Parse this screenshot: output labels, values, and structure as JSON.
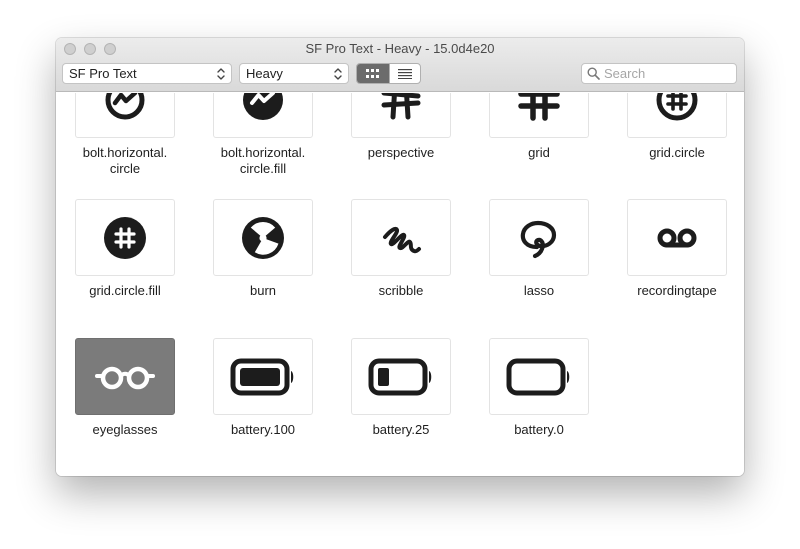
{
  "window": {
    "title": "SF Pro Text - Heavy - 15.0d4e20"
  },
  "toolbar": {
    "font_family": "SF Pro Text",
    "font_weight": "Heavy",
    "view_modes": [
      "grid-view",
      "list-view"
    ],
    "active_view": "grid-view",
    "search_placeholder": "Search"
  },
  "symbols": [
    {
      "name": "bolt.horizontal.circle",
      "label": "bolt.horizontal.\ncircle",
      "icon": "bolt-horizontal-circle-icon"
    },
    {
      "name": "bolt.horizontal.circle.fill",
      "label": "bolt.horizontal.\ncircle.fill",
      "icon": "bolt-horizontal-circle-fill-icon"
    },
    {
      "name": "perspective",
      "label": "perspective",
      "icon": "perspective-icon"
    },
    {
      "name": "grid",
      "label": "grid",
      "icon": "grid-icon"
    },
    {
      "name": "grid.circle",
      "label": "grid.circle",
      "icon": "grid-circle-icon"
    },
    {
      "name": "grid.circle.fill",
      "label": "grid.circle.fill",
      "icon": "grid-circle-fill-icon"
    },
    {
      "name": "burn",
      "label": "burn",
      "icon": "burn-icon"
    },
    {
      "name": "scribble",
      "label": "scribble",
      "icon": "scribble-icon"
    },
    {
      "name": "lasso",
      "label": "lasso",
      "icon": "lasso-icon"
    },
    {
      "name": "recordingtape",
      "label": "recordingtape",
      "icon": "recordingtape-icon"
    },
    {
      "name": "eyeglasses",
      "label": "eyeglasses",
      "icon": "eyeglasses-icon",
      "selected": true
    },
    {
      "name": "battery.100",
      "label": "battery.100",
      "icon": "battery-100-icon"
    },
    {
      "name": "battery.25",
      "label": "battery.25",
      "icon": "battery-25-icon"
    },
    {
      "name": "battery.0",
      "label": "battery.0",
      "icon": "battery-0-icon"
    }
  ],
  "colors": {
    "icon": "#1c1c1c",
    "selected_tile": "#7b7b7b",
    "selected_icon": "#ffffff"
  }
}
